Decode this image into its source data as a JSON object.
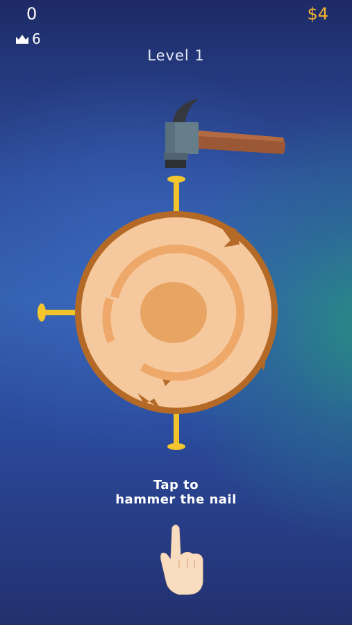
{
  "hud": {
    "score": "0",
    "best_score": "6",
    "money": "$4",
    "crown_icon": "crown-icon"
  },
  "level": {
    "label": "Level 1"
  },
  "game": {
    "target": "wood-log",
    "tool": "hammer",
    "nails_count": 3
  },
  "instruction": {
    "line1": "Tap to",
    "line2": "hammer the nail"
  },
  "colors": {
    "money": "#f2b233",
    "wood_bark": "#b46a26",
    "wood_light": "#f5c99d",
    "wood_ring": "#e8a463",
    "nail": "#f0c22c"
  }
}
